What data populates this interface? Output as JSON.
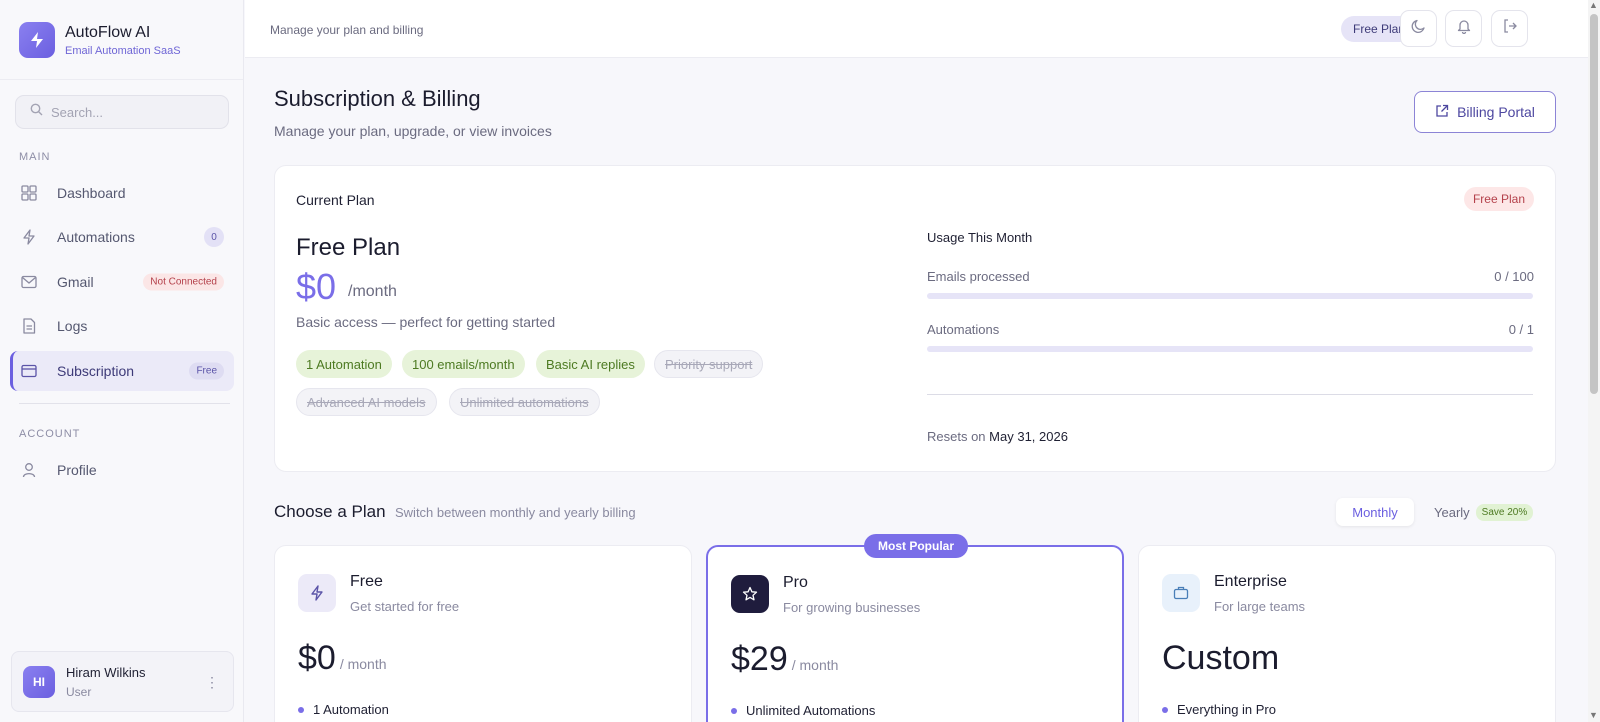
{
  "brand": {
    "name": "AutoFlow AI",
    "subtitle": "Email Automation SaaS"
  },
  "search": {
    "placeholder": "Search..."
  },
  "sidebar": {
    "main_label": "MAIN",
    "account_label": "ACCOUNT",
    "items": [
      {
        "label": "Dashboard",
        "icon": "grid-icon"
      },
      {
        "label": "Automations",
        "icon": "bolt-icon",
        "badge": "0"
      },
      {
        "label": "Gmail",
        "icon": "mail-icon",
        "badge": "Not Connected"
      },
      {
        "label": "Logs",
        "icon": "document-icon"
      },
      {
        "label": "Subscription",
        "icon": "card-icon",
        "badge": "Free",
        "active": true
      }
    ],
    "account_items": [
      {
        "label": "Profile",
        "icon": "user-icon"
      }
    ],
    "user": {
      "initials": "HI",
      "name": "Hiram Wilkins",
      "role": "User"
    }
  },
  "topbar": {
    "subtitle": "Manage your plan and billing",
    "plan_pill": "Free Plan"
  },
  "page": {
    "title": "Subscription & Billing",
    "subtitle": "Manage your plan, upgrade, or view invoices",
    "billing_portal_label": "Billing Portal"
  },
  "current_plan": {
    "label": "Current Plan",
    "badge": "Free Plan",
    "name": "Free Plan",
    "price": "$0",
    "per": "/month",
    "description": "Basic access — perfect for getting started",
    "features_included": [
      "1 Automation",
      "100 emails/month",
      "Basic AI replies"
    ],
    "features_excluded": [
      "Priority support",
      "Advanced AI models",
      "Unlimited automations"
    ],
    "usage": {
      "title": "Usage This Month",
      "rows": [
        {
          "label": "Emails processed",
          "value": "0 / 100",
          "fraction": 0
        },
        {
          "label": "Automations",
          "value": "0 / 1",
          "fraction": 0
        }
      ],
      "resets_label": "Resets on",
      "resets_date": "May 31, 2026"
    }
  },
  "choose_plan": {
    "title": "Choose a Plan",
    "subtitle": "Switch between monthly and yearly billing",
    "toggle": {
      "monthly": "Monthly",
      "yearly": "Yearly",
      "save": "Save 20%"
    },
    "popular_badge": "Most Popular",
    "plans": [
      {
        "name": "Free",
        "tagline": "Get started for free",
        "price": "$0",
        "per": "/ month",
        "feature": "1 Automation",
        "icon": "bolt-icon"
      },
      {
        "name": "Pro",
        "tagline": "For growing businesses",
        "price": "$29",
        "per": "/ month",
        "feature": "Unlimited Automations",
        "icon": "star-icon"
      },
      {
        "name": "Enterprise",
        "tagline": "For large teams",
        "price": "Custom",
        "per": "",
        "feature": "Everything in Pro",
        "icon": "briefcase-icon"
      }
    ]
  },
  "colors": {
    "accent": "#7a6ee8",
    "brand_gradient_start": "#8a80f0",
    "not_connected": "#b4414b",
    "included": "#4d7a22"
  }
}
